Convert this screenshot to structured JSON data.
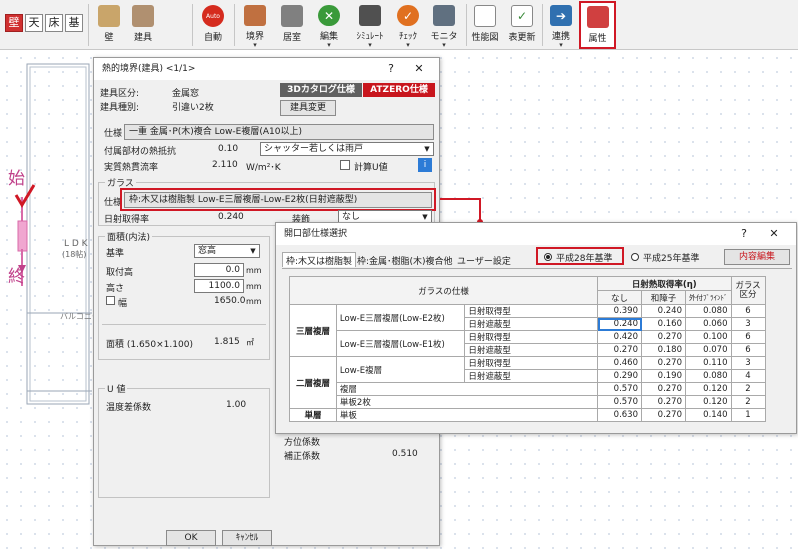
{
  "toolbar": {
    "kanji_buttons": [
      "壁",
      "天",
      "床",
      "基"
    ],
    "buttons": [
      {
        "label": "壁",
        "color": "#c9a56a"
      },
      {
        "label": "建具",
        "color": "#b09070"
      },
      {
        "label": "自動",
        "icon_text": "Auto",
        "color": "#d52b1e"
      },
      {
        "label": "境界",
        "color": "#c07040"
      },
      {
        "label": "居室",
        "color": "#808080"
      },
      {
        "label": "編集",
        "color": "#3a9a3a"
      },
      {
        "label": "ｼﾐｭﾚｰﾄ",
        "color": "#505050"
      },
      {
        "label": "ﾁｪｯｸ",
        "color": "#e07020"
      },
      {
        "label": "モニタ",
        "color": "#607080"
      },
      {
        "label": "性能図",
        "color": "#888888"
      },
      {
        "label": "表更新",
        "color": "#3a8a3a"
      },
      {
        "label": "連携",
        "color": "#3070b0"
      },
      {
        "label": "属性",
        "color": "#d04040"
      }
    ]
  },
  "canvas": {
    "ldk_label": "L D K",
    "ldk_sub": "(18帖)",
    "balcony": "バルコニー",
    "start": "始",
    "end": "終"
  },
  "dlg1": {
    "title": "熱的境界(建具)  <1/1>",
    "type_label": "建具区分:",
    "type_value": "金属窓",
    "kind_label": "建具種別:",
    "kind_value": "引違い2枚",
    "tag_catalog": "3Dカタログ仕様",
    "tag_atzero": "ATZERO仕様",
    "change_btn": "建具変更",
    "spec_label": "仕様",
    "spec_value": "一重 金属･P(木)複合 Low-E複層(A10以上)",
    "resist_label": "付属部材の熱抵抗",
    "resist_value": "0.10",
    "resist_select": "シャッター若しくは雨戸",
    "u_label": "実質熱貫流率",
    "u_value": "2.110",
    "u_unit": "W/m²･K",
    "calc_u": "計算U値",
    "glass_group": "ガラス",
    "glass_spec_label": "仕様",
    "glass_spec_value": "枠:木又は樹脂製 Low-E三層複層-Low-E2枚(日射遮蔽型)",
    "shgc_label": "日射取得率",
    "shgc_value": "0.240",
    "shade_label": "装飾",
    "shade_value": "なし",
    "area_group": "面積(内法)",
    "base_label": "基準",
    "base_value": "窓高",
    "sill_label": "取付高",
    "sill_value": "0.0",
    "height_label": "高さ",
    "height_value": "1100.0",
    "width_label": "幅",
    "width_value": "1650.0",
    "mm": "mm",
    "area_label": "面積 (1.650×1.100)",
    "area_value": "1.815",
    "area_unit": "㎡",
    "uval_group": "U 値",
    "temp_label": "温度差係数",
    "temp_value": "1.00",
    "dir_label": "方位係数",
    "corr_label": "補正係数",
    "corr_value": "0.510",
    "ok": "OK",
    "cancel": "ｷｬﾝｾﾙ"
  },
  "dlg2": {
    "title": "開口部仕様選択",
    "tabs": [
      "枠:木又は樹脂製",
      "枠:金属･樹脂(木)複合他",
      "ユーザー設定"
    ],
    "radio_h28": "平成28年基準",
    "radio_h25": "平成25年基準",
    "edit_btn": "内容編集",
    "col_glass": "ガラスの仕様",
    "col_shgc": "日射熱取得率(η)",
    "col_none": "なし",
    "col_shoji": "和障子",
    "col_blind": "外付ﾌﾞﾗｲﾝﾄﾞ",
    "col_class": "ガラス区分",
    "group_triple": "三層複層",
    "group_double": "二層複層",
    "group_single": "単層",
    "rows": [
      {
        "glass": "Low-E三層複層(Low-E2枚)",
        "type": "日射取得型",
        "none": "0.390",
        "shoji": "0.240",
        "blind": "0.080",
        "cls": "6"
      },
      {
        "glass": "",
        "type": "日射遮蔽型",
        "none": "0.240",
        "shoji": "0.160",
        "blind": "0.060",
        "cls": "3"
      },
      {
        "glass": "Low-E三層複層(Low-E1枚)",
        "type": "日射取得型",
        "none": "0.420",
        "shoji": "0.270",
        "blind": "0.100",
        "cls": "6"
      },
      {
        "glass": "",
        "type": "日射遮蔽型",
        "none": "0.270",
        "shoji": "0.180",
        "blind": "0.070",
        "cls": "6"
      },
      {
        "glass": "Low-E複層",
        "type": "日射取得型",
        "none": "0.460",
        "shoji": "0.270",
        "blind": "0.110",
        "cls": "3"
      },
      {
        "glass": "",
        "type": "日射遮蔽型",
        "none": "0.290",
        "shoji": "0.190",
        "blind": "0.080",
        "cls": "4"
      },
      {
        "glass": "複層",
        "type": "",
        "none": "0.570",
        "shoji": "0.270",
        "blind": "0.120",
        "cls": "2"
      },
      {
        "glass": "単板2枚",
        "type": "",
        "none": "0.570",
        "shoji": "0.270",
        "blind": "0.120",
        "cls": "2"
      },
      {
        "glass": "単板",
        "type": "",
        "none": "0.630",
        "shoji": "0.270",
        "blind": "0.140",
        "cls": "1"
      }
    ]
  }
}
